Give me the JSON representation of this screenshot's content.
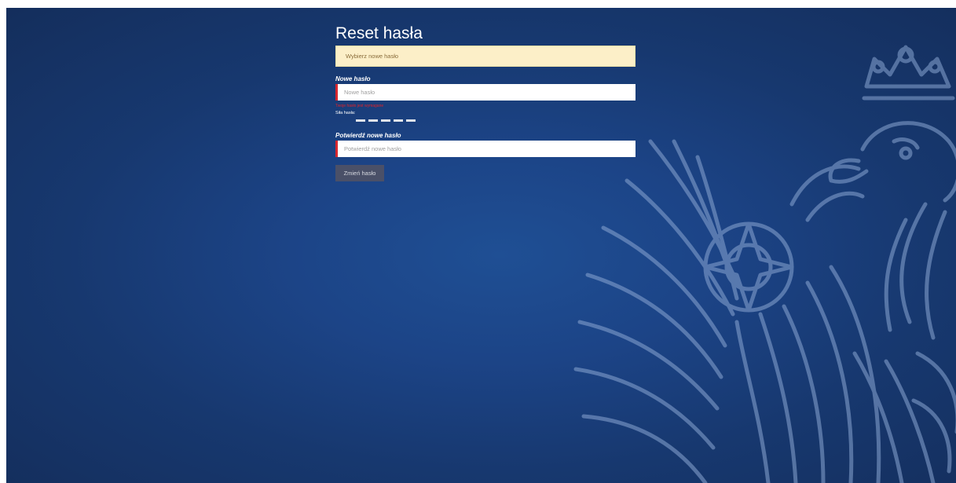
{
  "page": {
    "title": "Reset hasła",
    "alert": "Wybierz nowe hasło"
  },
  "new_password": {
    "label": "Nowe hasło",
    "placeholder": "Nowe hasło",
    "error": "Twoje hasło jest wymagane"
  },
  "strength": {
    "label": "Siła hasła:",
    "segments": 5
  },
  "confirm_password": {
    "label": "Potwierdź nowe hasło",
    "placeholder": "Potwierdź nowe hasło"
  },
  "submit": {
    "label": "Zmień hasło"
  },
  "colors": {
    "background": "#1c4487",
    "alert_bg": "#fcefc8",
    "error": "#d8262e",
    "button": "#4a5068"
  },
  "background_image": "eagle-emblem-icon"
}
